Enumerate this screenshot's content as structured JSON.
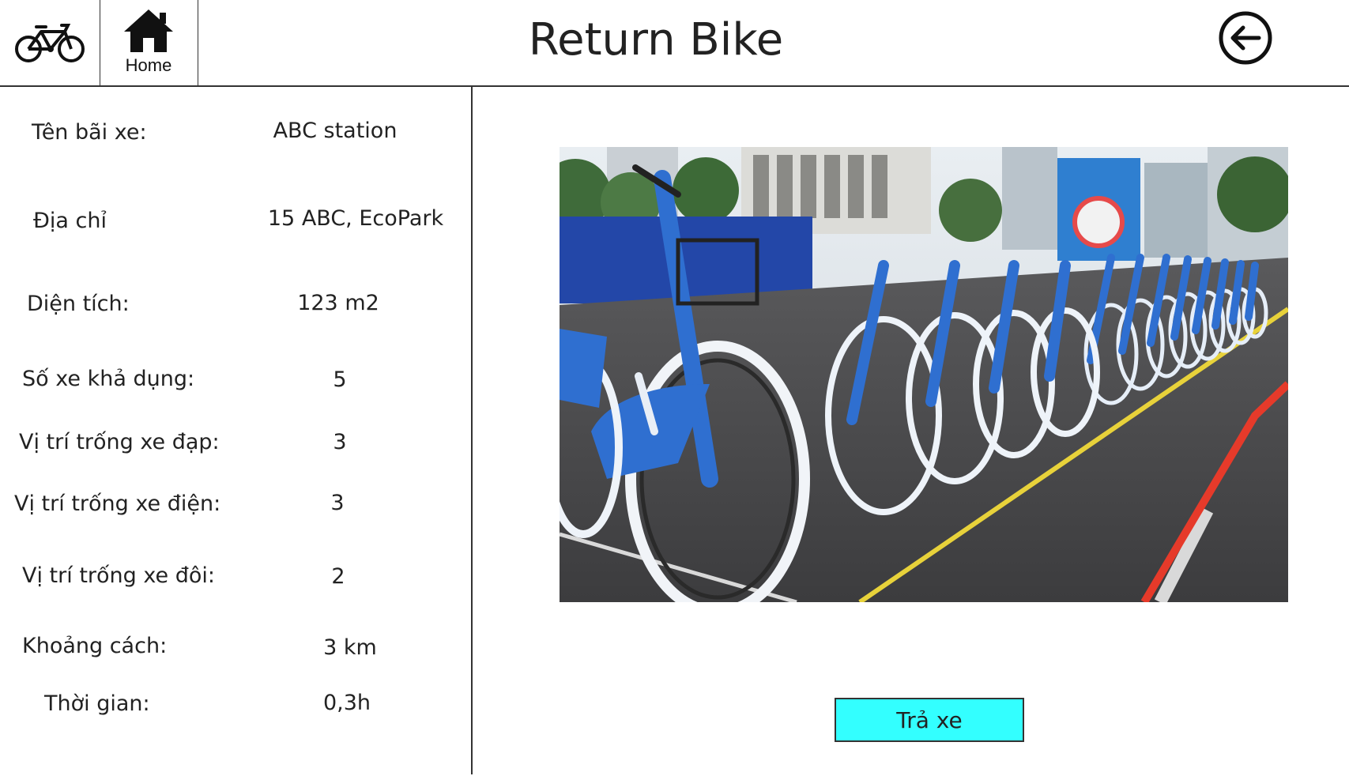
{
  "header": {
    "logo_icon": "bicycle-icon",
    "home_icon": "home-icon",
    "home_label": "Home",
    "title": "Return Bike",
    "back_icon": "back-arrow-icon"
  },
  "station": {
    "fields": [
      {
        "label": "Tên bãi xe:",
        "value": "ABC station"
      },
      {
        "label": "Địa chỉ",
        "value": "15 ABC, EcoPark"
      },
      {
        "label": "Diện tích:",
        "value": "123 m2"
      },
      {
        "label": "Số xe khả dụng:",
        "value": "5"
      },
      {
        "label": "Vị trí trống xe đạp:",
        "value": "3"
      },
      {
        "label": "Vị trí trống xe điện:",
        "value": "3"
      },
      {
        "label": "Vị trí trống xe đôi:",
        "value": "2"
      },
      {
        "label": "Khoảng cách:",
        "value": "3 km"
      },
      {
        "label": "Thời gian:",
        "value": "0,3h"
      }
    ]
  },
  "photo": {
    "subject": "row of blue rental bicycles at a docking station",
    "colors": {
      "bike": "#2f6fd0",
      "road": "#4a4a4a",
      "sky": "#dfe6ec",
      "lane_line": "#e8d23a"
    }
  },
  "actions": {
    "return_label": "Trả xe",
    "return_color": "#33ffff"
  }
}
